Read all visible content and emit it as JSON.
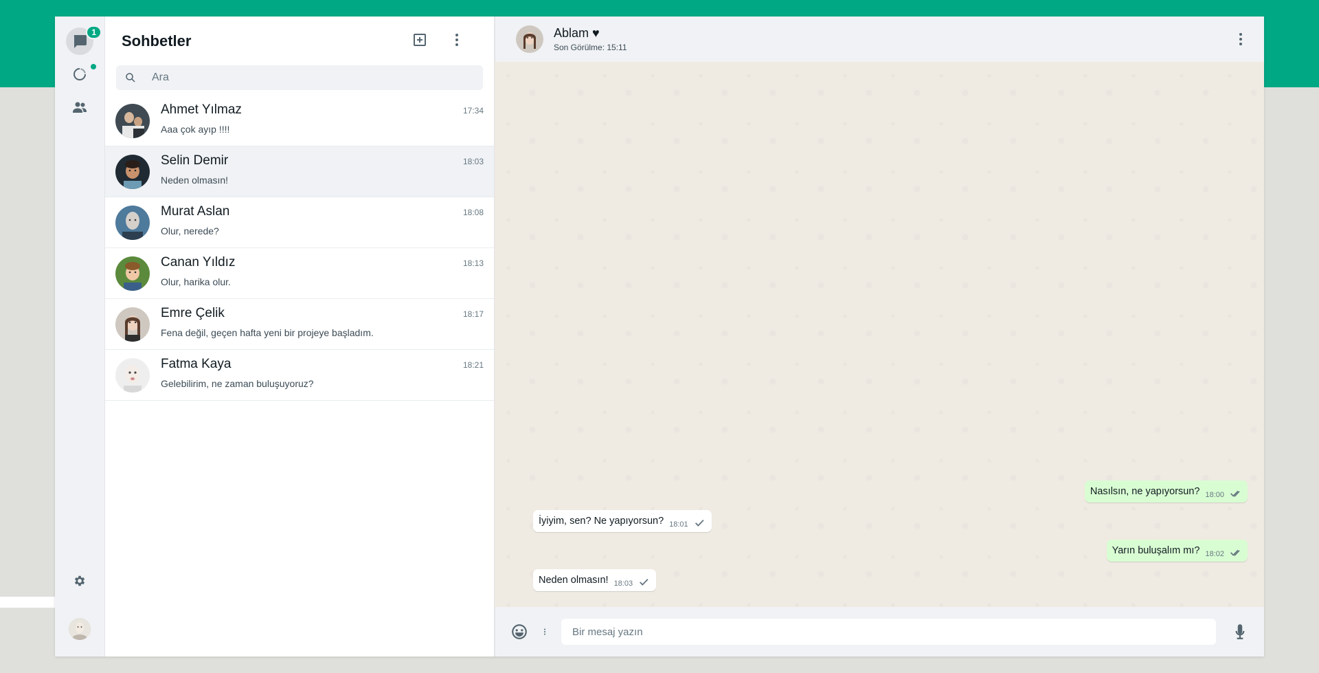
{
  "colors": {
    "brand": "#00a884",
    "outgoing_bubble": "#d9fdd3",
    "incoming_bubble": "#ffffff",
    "panel": "#f0f2f5",
    "chat_bg": "#efeae2"
  },
  "rail": {
    "chats_badge": "1",
    "icons": [
      "chat-icon",
      "status-icon",
      "communities-icon",
      "settings-icon"
    ]
  },
  "list": {
    "title": "Sohbetler",
    "search_placeholder": "Ara",
    "chats": [
      {
        "name": "Ahmet Yılmaz",
        "message": "Aaa çok ayıp !!!!",
        "time": "17:34"
      },
      {
        "name": "Selin Demir",
        "message": "Neden olmasın!",
        "time": "18:03"
      },
      {
        "name": "Murat Aslan",
        "message": "Olur, nerede?",
        "time": "18:08"
      },
      {
        "name": "Canan Yıldız",
        "message": "Olur, harika olur.",
        "time": "18:13"
      },
      {
        "name": "Emre Çelik",
        "message": "Fena değil, geçen hafta yeni bir projeye başladım.",
        "time": "18:17"
      },
      {
        "name": "Fatma Kaya",
        "message": "Gelebilirim, ne zaman buluşuyoruz?",
        "time": "18:21"
      }
    ]
  },
  "conversation": {
    "name": "Ablam ♥",
    "status": "Son Görülme: 15:11",
    "messages": [
      {
        "direction": "out",
        "text": "Nasılsın, ne yapıyorsun?",
        "time": "18:00",
        "ticks": "double"
      },
      {
        "direction": "in",
        "text": "İyiyim, sen? Ne yapıyorsun?",
        "time": "18:01",
        "ticks": "single"
      },
      {
        "direction": "out",
        "text": "Yarın buluşalım mı?",
        "time": "18:02",
        "ticks": "double"
      },
      {
        "direction": "in",
        "text": "Neden olmasın!",
        "time": "18:03",
        "ticks": "single"
      }
    ],
    "composer_placeholder": "Bir mesaj yazın"
  }
}
